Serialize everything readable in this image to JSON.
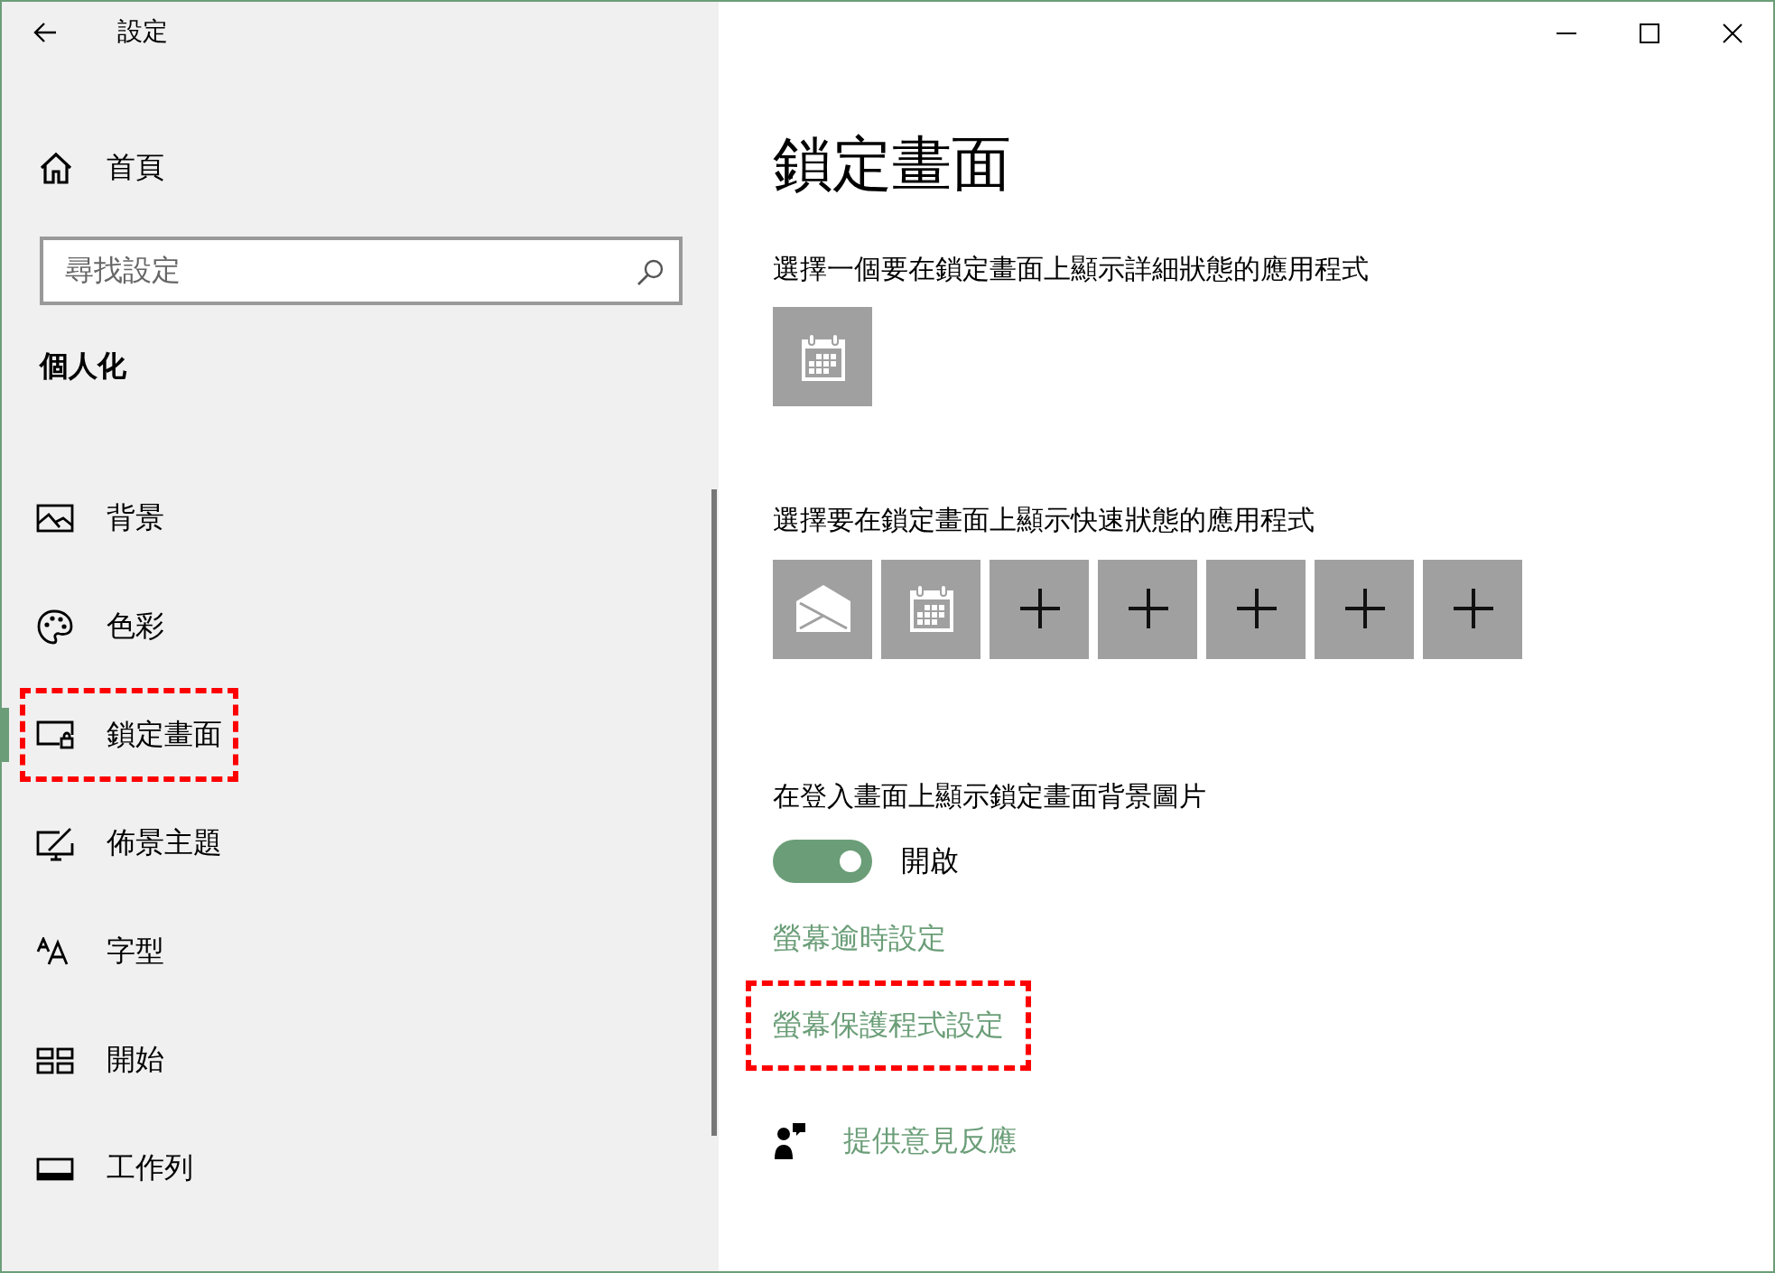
{
  "window": {
    "title": "設定"
  },
  "sidebar": {
    "home": "首頁",
    "search": {
      "placeholder": "尋找設定"
    },
    "section": "個人化",
    "items": [
      {
        "label": "背景",
        "kind": "background",
        "selected": false,
        "highlighted": false
      },
      {
        "label": "色彩",
        "kind": "colors",
        "selected": false,
        "highlighted": false
      },
      {
        "label": "鎖定畫面",
        "kind": "lockscreen",
        "selected": true,
        "highlighted": true
      },
      {
        "label": "佈景主題",
        "kind": "themes",
        "selected": false,
        "highlighted": false
      },
      {
        "label": "字型",
        "kind": "fonts",
        "selected": false,
        "highlighted": false
      },
      {
        "label": "開始",
        "kind": "start",
        "selected": false,
        "highlighted": false
      },
      {
        "label": "工作列",
        "kind": "taskbar",
        "selected": false,
        "highlighted": false
      }
    ]
  },
  "main": {
    "title": "鎖定畫面",
    "detailed": {
      "label": "選擇一個要在鎖定畫面上顯示詳細狀態的應用程式",
      "apps": [
        {
          "kind": "calendar"
        }
      ]
    },
    "quick": {
      "label": "選擇要在鎖定畫面上顯示快速狀態的應用程式",
      "apps": [
        {
          "kind": "mail"
        },
        {
          "kind": "calendar"
        },
        {
          "kind": "add"
        },
        {
          "kind": "add"
        },
        {
          "kind": "add"
        },
        {
          "kind": "add"
        },
        {
          "kind": "add"
        }
      ]
    },
    "signin_background": {
      "label": "在登入畫面上顯示鎖定畫面背景圖片",
      "on": true,
      "state_label": "開啟"
    },
    "links": [
      {
        "label": "螢幕逾時設定",
        "highlighted": false
      },
      {
        "label": "螢幕保護程式設定",
        "highlighted": true
      }
    ],
    "feedback": "提供意見反應"
  }
}
